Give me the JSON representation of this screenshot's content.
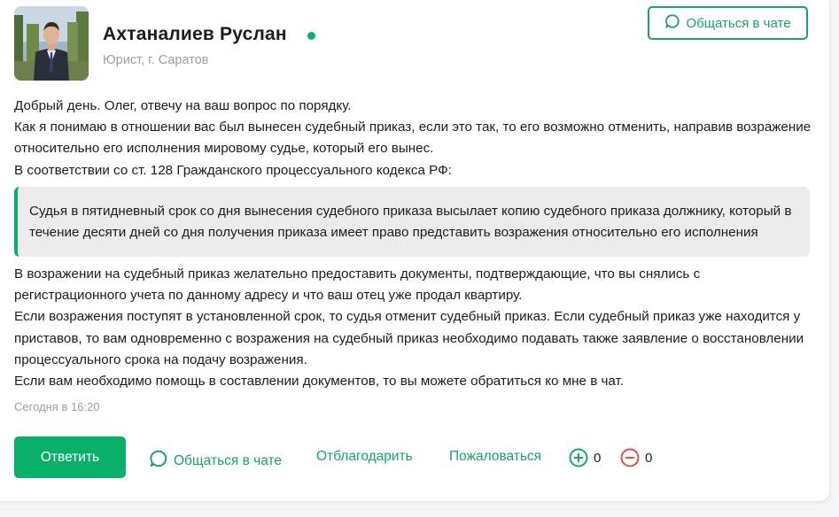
{
  "author": {
    "name": "Ахтаналиев Руслан",
    "meta": "Юрист, г. Саратов",
    "online": true,
    "chat_button": "Общаться в чате"
  },
  "answer": {
    "paragraphs_before": [
      "Добрый день. Олег, отвечу на ваш вопрос по порядку.",
      "Как я понимаю в отношении вас был вынесен судебный приказ, если это так, то его возможно отменить, направив возражение относительно его исполнения мировому судье, который его вынес.",
      "В соответствии со ст. 128 Гражданского процессуального кодекса РФ:"
    ],
    "quote": "Судья в пятидневный срок со дня вынесения судебного приказа высылает копию судебного приказа должнику, который в течение десяти дней со дня получения приказа имеет право представить возражения относительно его исполнения",
    "paragraphs_after": [
      "В возражении на судебный приказ желательно предоставить документы, подтверждающие, что вы снялись с регистрационного учета по данному адресу и что ваш отец уже продал квартиру.",
      "Если возражения поступят в установленной срок, то судья отменит судебный приказ. Если судебный приказ уже находится у приставов, то вам одновременно с возражения на судебный приказ необходимо подавать также заявление о восстановлении процессуального срока на подачу возражения.",
      "Если вам необходимо помощь в составлении документов, то вы можете обратиться ко мне в чат."
    ],
    "timestamp": "Сегодня в 16:20"
  },
  "actions": {
    "reply": "Ответить",
    "chat": "Общаться в чате",
    "thank": "Отблагодарить",
    "complain": "Пожаловаться",
    "upvotes": "0",
    "downvotes": "0"
  },
  "colors": {
    "accent": "#08b06a",
    "accent_text": "#18a463",
    "downvote": "#d9534f"
  },
  "icons": {
    "chat": "chat-bubble-icon",
    "plus": "plus-circle-icon",
    "minus": "minus-circle-icon"
  }
}
